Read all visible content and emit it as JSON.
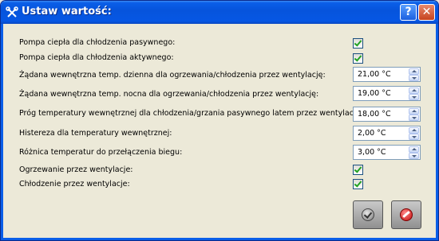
{
  "window": {
    "title": "Ustaw wartość:",
    "help_glyph": "?",
    "close_glyph": "✕",
    "title_icon": "tools-icon"
  },
  "colors": {
    "titlebar": "#0654dc",
    "dialog_bg": "#ece9d8",
    "check": "#21a121"
  },
  "rows": [
    {
      "label": "Pompa ciepła dla chłodzenia pasywnego:",
      "type": "checkbox",
      "checked": true
    },
    {
      "label": "Pompa ciepła dla chłodzenia aktywnego:",
      "type": "checkbox",
      "checked": true
    },
    {
      "label": "Żądana wewnętrzna temp. dzienna dla ogrzewania/chłodzenia przez wentylację:",
      "type": "spinner",
      "value": "21,00 °C"
    },
    {
      "label": "Żądana wewnętrzna temp. nocna dla ogrzewania/chłodzenia przez wentylację:",
      "type": "spinner",
      "value": "19,00 °C"
    },
    {
      "label": "Próg temperatury wewnętrznej dla chłodzenia/grzania pasywnego latem przez wentylację:",
      "type": "spinner",
      "value": "18,00 °C"
    },
    {
      "label": "Histereza dla temperatury wewnętrznej:",
      "type": "spinner",
      "value": "2,00 °C"
    },
    {
      "label": "Różnica temperatur do przełączenia biegu:",
      "type": "spinner",
      "value": "3,00 °C"
    },
    {
      "label": "Ogrzewanie przez wentylacje:",
      "type": "checkbox",
      "checked": true
    },
    {
      "label": "Chłodzenie przez wentylacje:",
      "type": "checkbox",
      "checked": true
    }
  ],
  "buttons": {
    "ok_icon": "ok-check-icon",
    "cancel_icon": "cancel-icon"
  }
}
